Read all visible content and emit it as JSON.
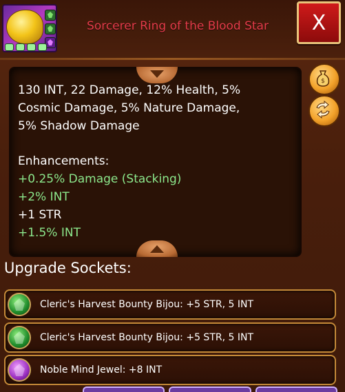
{
  "header": {
    "title": "Sorcerer Ring of the Blood Star",
    "close_label": "X",
    "item_icon": "golden-cat-head-icon"
  },
  "side_buttons": {
    "sell_icon": "money-bag-icon",
    "refresh_icon": "swap-arrows-icon"
  },
  "stats": {
    "line1": "130 INT, 22 Damage, 12% Health, 5%",
    "line2": "Cosmic Damage, 5% Nature Damage,",
    "line3": "5% Shadow Damage"
  },
  "enhancements": {
    "heading": "Enhancements:",
    "items": [
      {
        "text": "+0.25% Damage (Stacking)",
        "color": "#8ce88c"
      },
      {
        "text": "+2% INT",
        "color": "#8ce88c"
      },
      {
        "text": "+1 STR",
        "color": "#ffffff"
      },
      {
        "text": "+1.5% INT",
        "color": "#8ce88c"
      }
    ]
  },
  "sockets": {
    "title": "Upgrade Sockets:",
    "items": [
      {
        "label": "Cleric's Harvest Bounty Bijou: +5 STR, 5 INT",
        "gem": "green-gem-icon"
      },
      {
        "label": "Cleric's Harvest Bounty Bijou: +5 STR, 5 INT",
        "gem": "green-gem-icon"
      },
      {
        "label": "Noble Mind Jewel: +8 INT",
        "gem": "purple-gem-icon"
      }
    ]
  },
  "colors": {
    "title_red": "#e23b49",
    "enhancement_green": "#8ce88c",
    "panel_bg": "#2a1206",
    "socket_border": "#c58a38"
  }
}
